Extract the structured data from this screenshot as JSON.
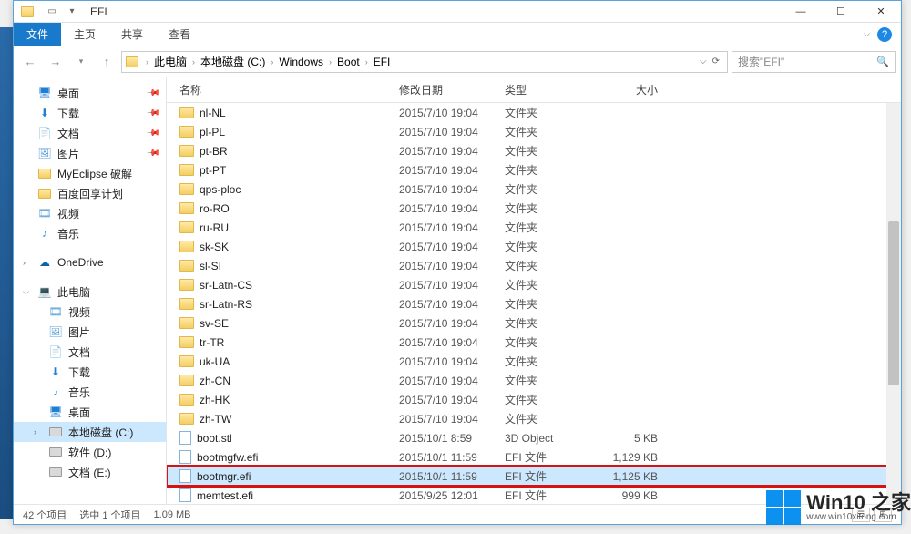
{
  "title": "EFI",
  "ribbon": {
    "file": "文件",
    "home": "主页",
    "share": "共享",
    "view": "查看"
  },
  "breadcrumb": [
    "此电脑",
    "本地磁盘 (C:)",
    "Windows",
    "Boot",
    "EFI"
  ],
  "search_placeholder": "搜索\"EFI\"",
  "columns": {
    "name": "名称",
    "date": "修改日期",
    "type": "类型",
    "size": "大小"
  },
  "sidebar": {
    "quick": [
      {
        "label": "桌面",
        "icon": "desktop",
        "pin": true
      },
      {
        "label": "下载",
        "icon": "download",
        "pin": true
      },
      {
        "label": "文档",
        "icon": "doc",
        "pin": true
      },
      {
        "label": "图片",
        "icon": "pic",
        "pin": true
      },
      {
        "label": "MyEclipse 破解",
        "icon": "folder",
        "pin": false
      },
      {
        "label": "百度回享计划",
        "icon": "folder",
        "pin": false
      },
      {
        "label": "视频",
        "icon": "video",
        "pin": false
      },
      {
        "label": "音乐",
        "icon": "music",
        "pin": false
      }
    ],
    "onedrive": "OneDrive",
    "thispc": "此电脑",
    "pc_items": [
      {
        "label": "视频",
        "icon": "video"
      },
      {
        "label": "图片",
        "icon": "pic"
      },
      {
        "label": "文档",
        "icon": "doc"
      },
      {
        "label": "下载",
        "icon": "download"
      },
      {
        "label": "音乐",
        "icon": "music"
      },
      {
        "label": "桌面",
        "icon": "desktop"
      },
      {
        "label": "本地磁盘 (C:)",
        "icon": "drive",
        "sel": true
      },
      {
        "label": "软件 (D:)",
        "icon": "drive"
      },
      {
        "label": "文档 (E:)",
        "icon": "drive"
      }
    ]
  },
  "files": [
    {
      "name": "nl-NL",
      "date": "2015/7/10 19:04",
      "type": "文件夹",
      "size": "",
      "kind": "folder"
    },
    {
      "name": "pl-PL",
      "date": "2015/7/10 19:04",
      "type": "文件夹",
      "size": "",
      "kind": "folder"
    },
    {
      "name": "pt-BR",
      "date": "2015/7/10 19:04",
      "type": "文件夹",
      "size": "",
      "kind": "folder"
    },
    {
      "name": "pt-PT",
      "date": "2015/7/10 19:04",
      "type": "文件夹",
      "size": "",
      "kind": "folder"
    },
    {
      "name": "qps-ploc",
      "date": "2015/7/10 19:04",
      "type": "文件夹",
      "size": "",
      "kind": "folder"
    },
    {
      "name": "ro-RO",
      "date": "2015/7/10 19:04",
      "type": "文件夹",
      "size": "",
      "kind": "folder"
    },
    {
      "name": "ru-RU",
      "date": "2015/7/10 19:04",
      "type": "文件夹",
      "size": "",
      "kind": "folder"
    },
    {
      "name": "sk-SK",
      "date": "2015/7/10 19:04",
      "type": "文件夹",
      "size": "",
      "kind": "folder"
    },
    {
      "name": "sl-SI",
      "date": "2015/7/10 19:04",
      "type": "文件夹",
      "size": "",
      "kind": "folder"
    },
    {
      "name": "sr-Latn-CS",
      "date": "2015/7/10 19:04",
      "type": "文件夹",
      "size": "",
      "kind": "folder"
    },
    {
      "name": "sr-Latn-RS",
      "date": "2015/7/10 19:04",
      "type": "文件夹",
      "size": "",
      "kind": "folder"
    },
    {
      "name": "sv-SE",
      "date": "2015/7/10 19:04",
      "type": "文件夹",
      "size": "",
      "kind": "folder"
    },
    {
      "name": "tr-TR",
      "date": "2015/7/10 19:04",
      "type": "文件夹",
      "size": "",
      "kind": "folder"
    },
    {
      "name": "uk-UA",
      "date": "2015/7/10 19:04",
      "type": "文件夹",
      "size": "",
      "kind": "folder"
    },
    {
      "name": "zh-CN",
      "date": "2015/7/10 19:04",
      "type": "文件夹",
      "size": "",
      "kind": "folder"
    },
    {
      "name": "zh-HK",
      "date": "2015/7/10 19:04",
      "type": "文件夹",
      "size": "",
      "kind": "folder"
    },
    {
      "name": "zh-TW",
      "date": "2015/7/10 19:04",
      "type": "文件夹",
      "size": "",
      "kind": "folder"
    },
    {
      "name": "boot.stl",
      "date": "2015/10/1 8:59",
      "type": "3D Object",
      "size": "5 KB",
      "kind": "file"
    },
    {
      "name": "bootmgfw.efi",
      "date": "2015/10/1 11:59",
      "type": "EFI 文件",
      "size": "1,129 KB",
      "kind": "file"
    },
    {
      "name": "bootmgr.efi",
      "date": "2015/10/1 11:59",
      "type": "EFI 文件",
      "size": "1,125 KB",
      "kind": "file",
      "sel": true,
      "hl": true
    },
    {
      "name": "memtest.efi",
      "date": "2015/9/25 12:01",
      "type": "EFI 文件",
      "size": "999 KB",
      "kind": "file"
    }
  ],
  "status": {
    "count": "42 个项目",
    "sel": "选中 1 个项目",
    "size": "1.09 MB"
  },
  "watermark": {
    "big": "Win10 之家",
    "small": "www.win10xitong.com"
  }
}
